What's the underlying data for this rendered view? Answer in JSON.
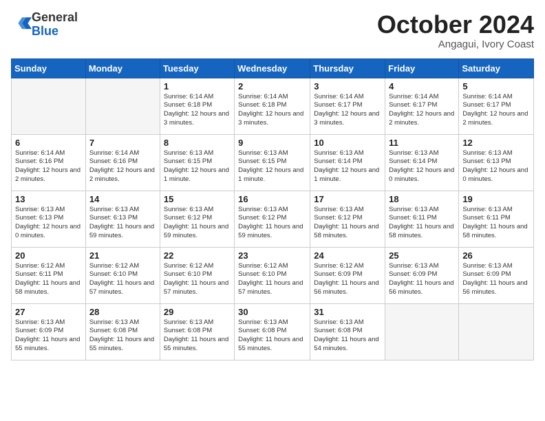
{
  "header": {
    "logo_general": "General",
    "logo_blue": "Blue",
    "month": "October 2024",
    "location": "Angagui, Ivory Coast"
  },
  "weekdays": [
    "Sunday",
    "Monday",
    "Tuesday",
    "Wednesday",
    "Thursday",
    "Friday",
    "Saturday"
  ],
  "weeks": [
    [
      {
        "day": "",
        "info": ""
      },
      {
        "day": "",
        "info": ""
      },
      {
        "day": "1",
        "info": "Sunrise: 6:14 AM\nSunset: 6:18 PM\nDaylight: 12 hours and 3 minutes."
      },
      {
        "day": "2",
        "info": "Sunrise: 6:14 AM\nSunset: 6:18 PM\nDaylight: 12 hours and 3 minutes."
      },
      {
        "day": "3",
        "info": "Sunrise: 6:14 AM\nSunset: 6:17 PM\nDaylight: 12 hours and 3 minutes."
      },
      {
        "day": "4",
        "info": "Sunrise: 6:14 AM\nSunset: 6:17 PM\nDaylight: 12 hours and 2 minutes."
      },
      {
        "day": "5",
        "info": "Sunrise: 6:14 AM\nSunset: 6:17 PM\nDaylight: 12 hours and 2 minutes."
      }
    ],
    [
      {
        "day": "6",
        "info": "Sunrise: 6:14 AM\nSunset: 6:16 PM\nDaylight: 12 hours and 2 minutes."
      },
      {
        "day": "7",
        "info": "Sunrise: 6:14 AM\nSunset: 6:16 PM\nDaylight: 12 hours and 2 minutes."
      },
      {
        "day": "8",
        "info": "Sunrise: 6:13 AM\nSunset: 6:15 PM\nDaylight: 12 hours and 1 minute."
      },
      {
        "day": "9",
        "info": "Sunrise: 6:13 AM\nSunset: 6:15 PM\nDaylight: 12 hours and 1 minute."
      },
      {
        "day": "10",
        "info": "Sunrise: 6:13 AM\nSunset: 6:14 PM\nDaylight: 12 hours and 1 minute."
      },
      {
        "day": "11",
        "info": "Sunrise: 6:13 AM\nSunset: 6:14 PM\nDaylight: 12 hours and 0 minutes."
      },
      {
        "day": "12",
        "info": "Sunrise: 6:13 AM\nSunset: 6:13 PM\nDaylight: 12 hours and 0 minutes."
      }
    ],
    [
      {
        "day": "13",
        "info": "Sunrise: 6:13 AM\nSunset: 6:13 PM\nDaylight: 12 hours and 0 minutes."
      },
      {
        "day": "14",
        "info": "Sunrise: 6:13 AM\nSunset: 6:13 PM\nDaylight: 11 hours and 59 minutes."
      },
      {
        "day": "15",
        "info": "Sunrise: 6:13 AM\nSunset: 6:12 PM\nDaylight: 11 hours and 59 minutes."
      },
      {
        "day": "16",
        "info": "Sunrise: 6:13 AM\nSunset: 6:12 PM\nDaylight: 11 hours and 59 minutes."
      },
      {
        "day": "17",
        "info": "Sunrise: 6:13 AM\nSunset: 6:12 PM\nDaylight: 11 hours and 58 minutes."
      },
      {
        "day": "18",
        "info": "Sunrise: 6:13 AM\nSunset: 6:11 PM\nDaylight: 11 hours and 58 minutes."
      },
      {
        "day": "19",
        "info": "Sunrise: 6:13 AM\nSunset: 6:11 PM\nDaylight: 11 hours and 58 minutes."
      }
    ],
    [
      {
        "day": "20",
        "info": "Sunrise: 6:12 AM\nSunset: 6:11 PM\nDaylight: 11 hours and 58 minutes."
      },
      {
        "day": "21",
        "info": "Sunrise: 6:12 AM\nSunset: 6:10 PM\nDaylight: 11 hours and 57 minutes."
      },
      {
        "day": "22",
        "info": "Sunrise: 6:12 AM\nSunset: 6:10 PM\nDaylight: 11 hours and 57 minutes."
      },
      {
        "day": "23",
        "info": "Sunrise: 6:12 AM\nSunset: 6:10 PM\nDaylight: 11 hours and 57 minutes."
      },
      {
        "day": "24",
        "info": "Sunrise: 6:12 AM\nSunset: 6:09 PM\nDaylight: 11 hours and 56 minutes."
      },
      {
        "day": "25",
        "info": "Sunrise: 6:13 AM\nSunset: 6:09 PM\nDaylight: 11 hours and 56 minutes."
      },
      {
        "day": "26",
        "info": "Sunrise: 6:13 AM\nSunset: 6:09 PM\nDaylight: 11 hours and 56 minutes."
      }
    ],
    [
      {
        "day": "27",
        "info": "Sunrise: 6:13 AM\nSunset: 6:09 PM\nDaylight: 11 hours and 55 minutes."
      },
      {
        "day": "28",
        "info": "Sunrise: 6:13 AM\nSunset: 6:08 PM\nDaylight: 11 hours and 55 minutes."
      },
      {
        "day": "29",
        "info": "Sunrise: 6:13 AM\nSunset: 6:08 PM\nDaylight: 11 hours and 55 minutes."
      },
      {
        "day": "30",
        "info": "Sunrise: 6:13 AM\nSunset: 6:08 PM\nDaylight: 11 hours and 55 minutes."
      },
      {
        "day": "31",
        "info": "Sunrise: 6:13 AM\nSunset: 6:08 PM\nDaylight: 11 hours and 54 minutes."
      },
      {
        "day": "",
        "info": ""
      },
      {
        "day": "",
        "info": ""
      }
    ]
  ]
}
